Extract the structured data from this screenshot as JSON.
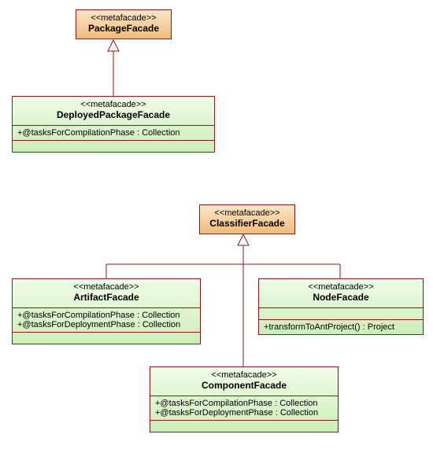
{
  "stereotypes": {
    "metafacade": "<<metafacade>>"
  },
  "classes": {
    "packageFacade": {
      "name": "PackageFacade"
    },
    "deployedPackageFacade": {
      "name": "DeployedPackageFacade",
      "attr1": "+@tasksForCompilationPhase : Collection"
    },
    "classifierFacade": {
      "name": "ClassifierFacade"
    },
    "artifactFacade": {
      "name": "ArtifactFacade",
      "attr1": "+@tasksForCompilationPhase : Collection",
      "attr2": "+@tasksForDeploymentPhase : Collection"
    },
    "nodeFacade": {
      "name": "NodeFacade",
      "op1": "+transformToAntProject() : Project"
    },
    "componentFacade": {
      "name": "ComponentFacade",
      "attr1": "+@tasksForCompilationPhase : Collection",
      "attr2": "+@tasksForDeploymentPhase : Collection"
    }
  }
}
